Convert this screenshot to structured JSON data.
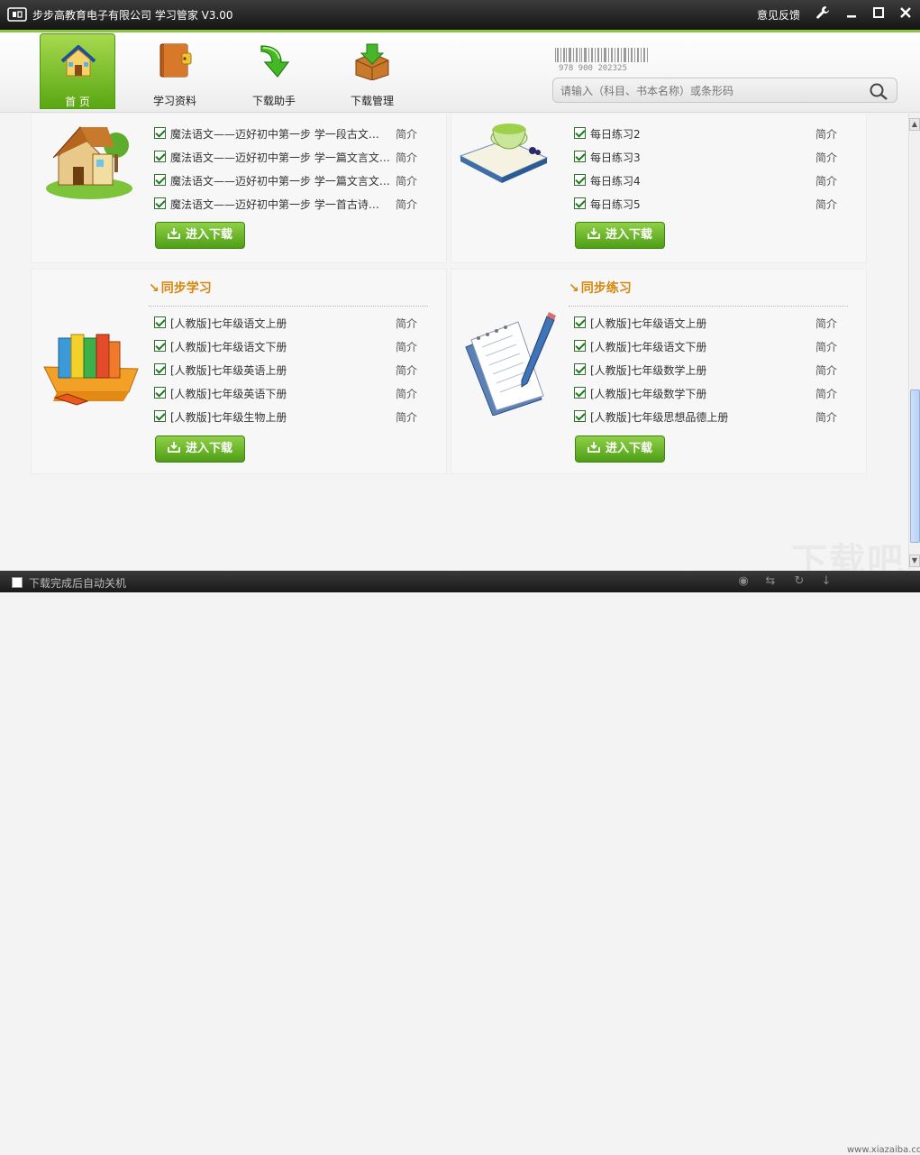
{
  "window": {
    "title": "步步高教育电子有限公司 学习管家 V3.00",
    "feedback": "意见反馈",
    "controls": [
      "settings-icon",
      "minimize-icon",
      "maximize-icon",
      "close-icon"
    ]
  },
  "nav": {
    "items": [
      {
        "label": "首 页",
        "icon": "home-icon",
        "active": true
      },
      {
        "label": "学习资料",
        "icon": "book-icon",
        "active": false
      },
      {
        "label": "下载助手",
        "icon": "download-arrow-icon",
        "active": false
      },
      {
        "label": "下载管理",
        "icon": "box-download-icon",
        "active": false
      }
    ]
  },
  "barcode": {
    "number": "978 900 202325"
  },
  "search": {
    "placeholder": "请输入（科目、书本名称）或条形码"
  },
  "panels": {
    "top_left": {
      "items": [
        {
          "text": "魔法语文——迈好初中第一步 学一段古文…",
          "intro": "简介"
        },
        {
          "text": "魔法语文——迈好初中第一步 学一篇文言文…",
          "intro": "简介"
        },
        {
          "text": "魔法语文——迈好初中第一步 学一篇文言文…",
          "intro": "简介"
        },
        {
          "text": "魔法语文——迈好初中第一步 学一首古诗…",
          "intro": "简介"
        }
      ],
      "button": "进入下载"
    },
    "top_right": {
      "items": [
        {
          "text": "每日练习2",
          "intro": "简介"
        },
        {
          "text": "每日练习3",
          "intro": "简介"
        },
        {
          "text": "每日练习4",
          "intro": "简介"
        },
        {
          "text": "每日练习5",
          "intro": "简介"
        }
      ],
      "button": "进入下载"
    },
    "bottom_left": {
      "title": "同步学习",
      "items": [
        {
          "text": "[人教版]七年级语文上册",
          "intro": "简介"
        },
        {
          "text": "[人教版]七年级语文下册",
          "intro": "简介"
        },
        {
          "text": "[人教版]七年级英语上册",
          "intro": "简介"
        },
        {
          "text": "[人教版]七年级英语下册",
          "intro": "简介"
        },
        {
          "text": "[人教版]七年级生物上册",
          "intro": "简介"
        }
      ],
      "button": "进入下载"
    },
    "bottom_right": {
      "title": "同步练习",
      "items": [
        {
          "text": "[人教版]七年级语文上册",
          "intro": "简介"
        },
        {
          "text": "[人教版]七年级语文下册",
          "intro": "简介"
        },
        {
          "text": "[人教版]七年级数学上册",
          "intro": "简介"
        },
        {
          "text": "[人教版]七年级数学下册",
          "intro": "简介"
        },
        {
          "text": "[人教版]七年级思想品德上册",
          "intro": "简介"
        }
      ],
      "button": "进入下载"
    }
  },
  "status": {
    "auto_shutdown": "下载完成后自动关机"
  },
  "watermark": {
    "logo": "下载吧",
    "site": "www.xiazaiba.com"
  },
  "colors": {
    "accent": "#6cb825",
    "section_title": "#d5860c",
    "titlebar": "#1e1e1e"
  }
}
